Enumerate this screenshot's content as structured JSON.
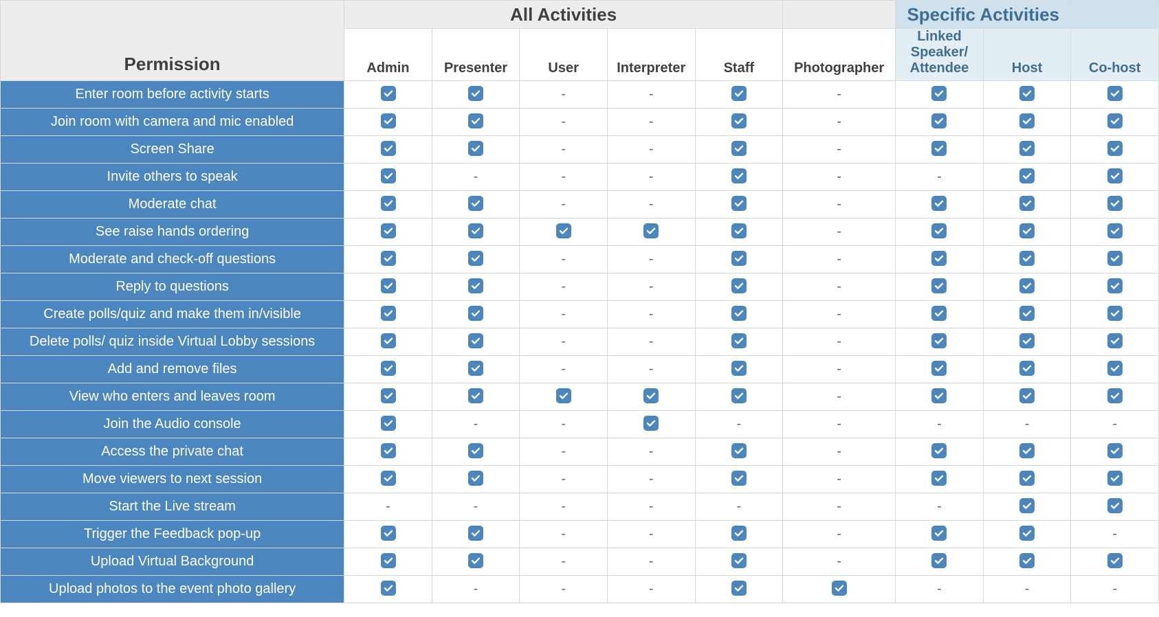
{
  "headers": {
    "permission": "Permission",
    "group_all": "All Activities",
    "group_specific": "Specific Activities",
    "roles": [
      {
        "key": "admin",
        "label": "Admin",
        "group": "all"
      },
      {
        "key": "presenter",
        "label": "Presenter",
        "group": "all"
      },
      {
        "key": "user",
        "label": "User",
        "group": "all"
      },
      {
        "key": "interpreter",
        "label": "Interpreter",
        "group": "all"
      },
      {
        "key": "staff",
        "label": "Staff",
        "group": "all"
      },
      {
        "key": "photographer",
        "label": "Photographer",
        "group": "none"
      },
      {
        "key": "linked",
        "label": "Linked\nSpeaker/\nAttendee",
        "group": "specific"
      },
      {
        "key": "host",
        "label": "Host",
        "group": "specific"
      },
      {
        "key": "cohost",
        "label": "Co-host",
        "group": "specific_blank"
      }
    ]
  },
  "permissions": [
    {
      "label": "Enter room before activity starts",
      "values": [
        true,
        true,
        false,
        false,
        true,
        false,
        true,
        true,
        true
      ]
    },
    {
      "label": "Join room with camera and mic enabled",
      "values": [
        true,
        true,
        false,
        false,
        true,
        false,
        true,
        true,
        true
      ]
    },
    {
      "label": "Screen Share",
      "values": [
        true,
        true,
        false,
        false,
        true,
        false,
        true,
        true,
        true
      ]
    },
    {
      "label": "Invite others to speak",
      "values": [
        true,
        false,
        false,
        false,
        true,
        false,
        false,
        true,
        true
      ]
    },
    {
      "label": "Moderate chat",
      "values": [
        true,
        true,
        false,
        false,
        true,
        false,
        true,
        true,
        true
      ]
    },
    {
      "label": "See raise hands ordering",
      "values": [
        true,
        true,
        true,
        true,
        true,
        false,
        true,
        true,
        true
      ]
    },
    {
      "label": "Moderate and check-off questions",
      "values": [
        true,
        true,
        false,
        false,
        true,
        false,
        true,
        true,
        true
      ]
    },
    {
      "label": "Reply to questions",
      "values": [
        true,
        true,
        false,
        false,
        true,
        false,
        true,
        true,
        true
      ]
    },
    {
      "label": "Create polls/quiz and make them in/visible",
      "values": [
        true,
        true,
        false,
        false,
        true,
        false,
        true,
        true,
        true
      ]
    },
    {
      "label": "Delete polls/ quiz inside Virtual Lobby sessions",
      "values": [
        true,
        true,
        false,
        false,
        true,
        false,
        true,
        true,
        true
      ]
    },
    {
      "label": "Add and remove files",
      "values": [
        true,
        true,
        false,
        false,
        true,
        false,
        true,
        true,
        true
      ]
    },
    {
      "label": "View who enters and leaves room",
      "values": [
        true,
        true,
        true,
        true,
        true,
        false,
        true,
        true,
        true
      ]
    },
    {
      "label": "Join the Audio console",
      "values": [
        true,
        false,
        false,
        true,
        false,
        false,
        false,
        false,
        false
      ]
    },
    {
      "label": "Access the private chat",
      "values": [
        true,
        true,
        false,
        false,
        true,
        false,
        true,
        true,
        true
      ]
    },
    {
      "label": "Move viewers to next session",
      "values": [
        true,
        true,
        false,
        false,
        true,
        false,
        true,
        true,
        true
      ]
    },
    {
      "label": "Start the Live stream",
      "values": [
        false,
        false,
        false,
        false,
        false,
        false,
        false,
        true,
        true
      ]
    },
    {
      "label": "Trigger the Feedback pop-up",
      "values": [
        true,
        true,
        false,
        false,
        true,
        false,
        true,
        true,
        false
      ]
    },
    {
      "label": "Upload Virtual Background",
      "values": [
        true,
        true,
        false,
        false,
        true,
        false,
        true,
        true,
        true
      ]
    },
    {
      "label": "Upload photos to the event photo gallery",
      "values": [
        true,
        false,
        false,
        false,
        true,
        true,
        false,
        false,
        false
      ]
    }
  ]
}
